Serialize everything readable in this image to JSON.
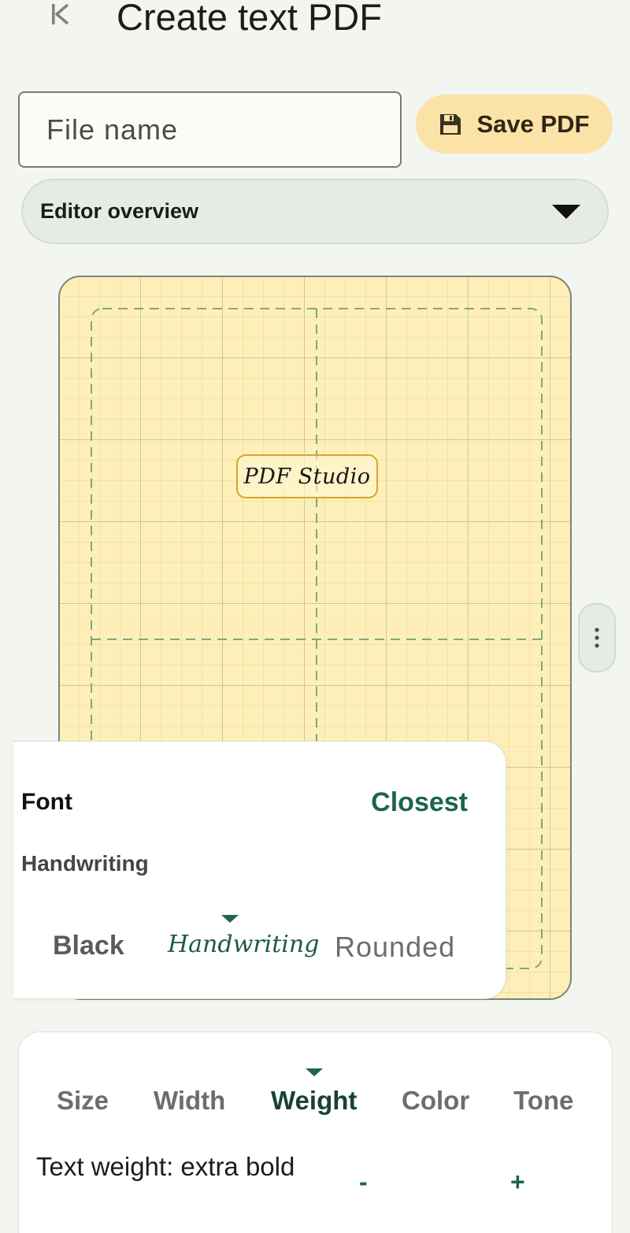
{
  "header": {
    "title": "Create text PDF",
    "back_icon": "skip-back-icon"
  },
  "file": {
    "placeholder": "File name",
    "value": ""
  },
  "save_button": {
    "label": "Save PDF",
    "icon": "floppy-disk-icon",
    "bg": "#fbe2a6"
  },
  "overview": {
    "label": "Editor overview",
    "icon": "caret-down-icon"
  },
  "canvas": {
    "page_color": "#fdefb7",
    "text_element": "PDF Studio",
    "accent": "#d4a72c"
  },
  "side_handle": {
    "icon": "more-vertical-icon"
  },
  "font_popup": {
    "title": "Font",
    "action": "Closest",
    "current": "Handwriting",
    "options": [
      "Black",
      "Handwriting",
      "Rounded"
    ],
    "selected": "Handwriting",
    "accent": "#1d6648"
  },
  "panel": {
    "tabs": [
      "Size",
      "Width",
      "Weight",
      "Color",
      "Tone"
    ],
    "active_tab": "Weight",
    "weight_label": "Text weight: extra bold",
    "decrease_label": "-",
    "increase_label": "+"
  }
}
